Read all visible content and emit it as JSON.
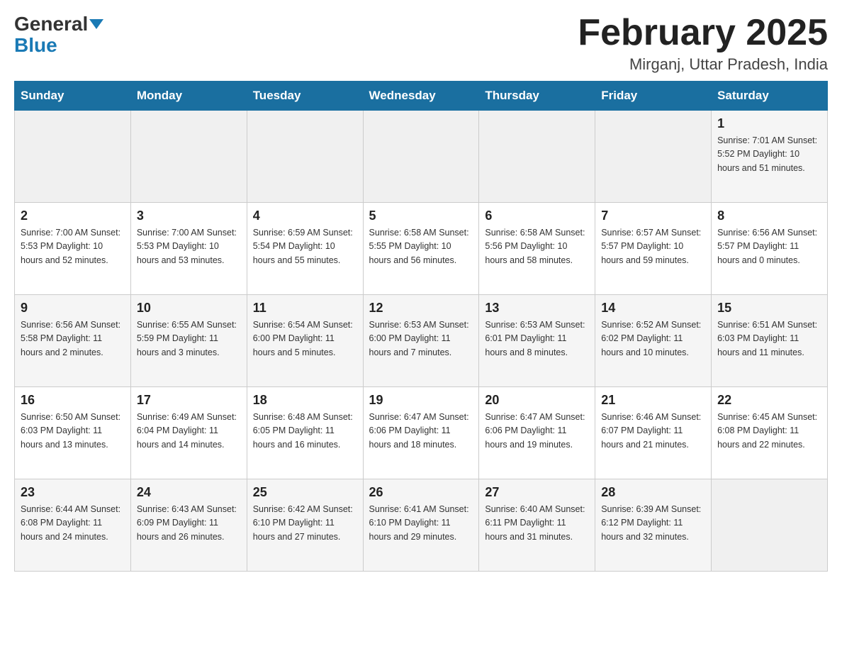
{
  "logo": {
    "general": "General",
    "blue": "Blue"
  },
  "title": "February 2025",
  "location": "Mirganj, Uttar Pradesh, India",
  "days_of_week": [
    "Sunday",
    "Monday",
    "Tuesday",
    "Wednesday",
    "Thursday",
    "Friday",
    "Saturday"
  ],
  "weeks": [
    [
      {
        "day": "",
        "info": ""
      },
      {
        "day": "",
        "info": ""
      },
      {
        "day": "",
        "info": ""
      },
      {
        "day": "",
        "info": ""
      },
      {
        "day": "",
        "info": ""
      },
      {
        "day": "",
        "info": ""
      },
      {
        "day": "1",
        "info": "Sunrise: 7:01 AM\nSunset: 5:52 PM\nDaylight: 10 hours\nand 51 minutes."
      }
    ],
    [
      {
        "day": "2",
        "info": "Sunrise: 7:00 AM\nSunset: 5:53 PM\nDaylight: 10 hours\nand 52 minutes."
      },
      {
        "day": "3",
        "info": "Sunrise: 7:00 AM\nSunset: 5:53 PM\nDaylight: 10 hours\nand 53 minutes."
      },
      {
        "day": "4",
        "info": "Sunrise: 6:59 AM\nSunset: 5:54 PM\nDaylight: 10 hours\nand 55 minutes."
      },
      {
        "day": "5",
        "info": "Sunrise: 6:58 AM\nSunset: 5:55 PM\nDaylight: 10 hours\nand 56 minutes."
      },
      {
        "day": "6",
        "info": "Sunrise: 6:58 AM\nSunset: 5:56 PM\nDaylight: 10 hours\nand 58 minutes."
      },
      {
        "day": "7",
        "info": "Sunrise: 6:57 AM\nSunset: 5:57 PM\nDaylight: 10 hours\nand 59 minutes."
      },
      {
        "day": "8",
        "info": "Sunrise: 6:56 AM\nSunset: 5:57 PM\nDaylight: 11 hours\nand 0 minutes."
      }
    ],
    [
      {
        "day": "9",
        "info": "Sunrise: 6:56 AM\nSunset: 5:58 PM\nDaylight: 11 hours\nand 2 minutes."
      },
      {
        "day": "10",
        "info": "Sunrise: 6:55 AM\nSunset: 5:59 PM\nDaylight: 11 hours\nand 3 minutes."
      },
      {
        "day": "11",
        "info": "Sunrise: 6:54 AM\nSunset: 6:00 PM\nDaylight: 11 hours\nand 5 minutes."
      },
      {
        "day": "12",
        "info": "Sunrise: 6:53 AM\nSunset: 6:00 PM\nDaylight: 11 hours\nand 7 minutes."
      },
      {
        "day": "13",
        "info": "Sunrise: 6:53 AM\nSunset: 6:01 PM\nDaylight: 11 hours\nand 8 minutes."
      },
      {
        "day": "14",
        "info": "Sunrise: 6:52 AM\nSunset: 6:02 PM\nDaylight: 11 hours\nand 10 minutes."
      },
      {
        "day": "15",
        "info": "Sunrise: 6:51 AM\nSunset: 6:03 PM\nDaylight: 11 hours\nand 11 minutes."
      }
    ],
    [
      {
        "day": "16",
        "info": "Sunrise: 6:50 AM\nSunset: 6:03 PM\nDaylight: 11 hours\nand 13 minutes."
      },
      {
        "day": "17",
        "info": "Sunrise: 6:49 AM\nSunset: 6:04 PM\nDaylight: 11 hours\nand 14 minutes."
      },
      {
        "day": "18",
        "info": "Sunrise: 6:48 AM\nSunset: 6:05 PM\nDaylight: 11 hours\nand 16 minutes."
      },
      {
        "day": "19",
        "info": "Sunrise: 6:47 AM\nSunset: 6:06 PM\nDaylight: 11 hours\nand 18 minutes."
      },
      {
        "day": "20",
        "info": "Sunrise: 6:47 AM\nSunset: 6:06 PM\nDaylight: 11 hours\nand 19 minutes."
      },
      {
        "day": "21",
        "info": "Sunrise: 6:46 AM\nSunset: 6:07 PM\nDaylight: 11 hours\nand 21 minutes."
      },
      {
        "day": "22",
        "info": "Sunrise: 6:45 AM\nSunset: 6:08 PM\nDaylight: 11 hours\nand 22 minutes."
      }
    ],
    [
      {
        "day": "23",
        "info": "Sunrise: 6:44 AM\nSunset: 6:08 PM\nDaylight: 11 hours\nand 24 minutes."
      },
      {
        "day": "24",
        "info": "Sunrise: 6:43 AM\nSunset: 6:09 PM\nDaylight: 11 hours\nand 26 minutes."
      },
      {
        "day": "25",
        "info": "Sunrise: 6:42 AM\nSunset: 6:10 PM\nDaylight: 11 hours\nand 27 minutes."
      },
      {
        "day": "26",
        "info": "Sunrise: 6:41 AM\nSunset: 6:10 PM\nDaylight: 11 hours\nand 29 minutes."
      },
      {
        "day": "27",
        "info": "Sunrise: 6:40 AM\nSunset: 6:11 PM\nDaylight: 11 hours\nand 31 minutes."
      },
      {
        "day": "28",
        "info": "Sunrise: 6:39 AM\nSunset: 6:12 PM\nDaylight: 11 hours\nand 32 minutes."
      },
      {
        "day": "",
        "info": ""
      }
    ]
  ]
}
